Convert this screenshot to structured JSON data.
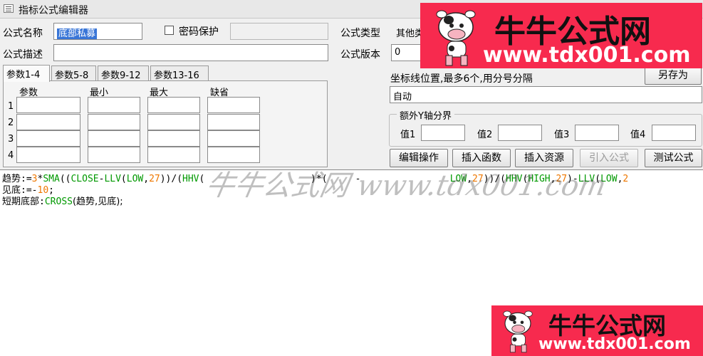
{
  "window": {
    "title": "指标公式编辑器"
  },
  "form": {
    "name_label": "公式名称",
    "name_value": "底部私募",
    "password_label": "密码保护",
    "password_value": "",
    "type_label": "公式类型",
    "type_value": "其他类",
    "desc_label": "公式描述",
    "desc_value": "",
    "version_label": "公式版本",
    "version_value": "0"
  },
  "tabs": [
    {
      "label": "参数1-4",
      "active": true
    },
    {
      "label": "参数5-8",
      "active": false
    },
    {
      "label": "参数9-12",
      "active": false
    },
    {
      "label": "参数13-16",
      "active": false
    }
  ],
  "params": {
    "headers": [
      "参数",
      "最小",
      "最大",
      "缺省"
    ],
    "rows": [
      "1",
      "2",
      "3",
      "4"
    ]
  },
  "coord": {
    "label": "坐标线位置,最多6个,用分号分隔",
    "value": "自动",
    "save_as_button": "另存为"
  },
  "yaxis": {
    "legend": "额外Y轴分界",
    "labels": [
      "值1",
      "值2",
      "值3",
      "值4"
    ]
  },
  "buttons": {
    "edit_ops": "编辑操作",
    "insert_func": "插入函数",
    "insert_resource": "插入资源",
    "import_formula": "引入公式",
    "test_formula": "测试公式"
  },
  "code": {
    "line1_name": "趋势",
    "line1_assign": ":=",
    "line1_n1": "3",
    "line1_star": "*",
    "line1_fn1": "SMA",
    "line1_p1": "((",
    "line1_fn2": "CLOSE",
    "line1_minus": "-",
    "line1_fn3": "LLV",
    "line1_p2": "(",
    "line1_fn4": "LOW",
    "line1_comma1": ",",
    "line1_n2": "27",
    "line1_p3": "))/(",
    "line1_fn5": "HHV",
    "line1_p4": "(",
    "line1_mid": "                   )*(     -                ",
    "line1_fn6": "LOW",
    "line1_comma2": ",",
    "line1_n3": "27",
    "line1_p5": "))/(",
    "line1_fn7": "HHV",
    "line1_p6": "(",
    "line1_fn8": "HIGH",
    "line1_comma3": ",",
    "line1_n4": "27",
    "line1_p7": ")-",
    "line1_fn9": "LLV",
    "line1_p8": "(",
    "line1_fn10": "LOW",
    "line1_comma4": ",",
    "line1_n5": "2",
    "line2_name": "见底",
    "line2_assign": ":=-",
    "line2_num": "10",
    "line2_end": ";",
    "line3_name": "短期底部",
    "line3_colon": ":",
    "line3_fn": "CROSS",
    "line3_args": "(趋势,见底);"
  },
  "ads": {
    "brand_name": "牛牛公式网",
    "url": "www.tdx001.com",
    "watermark": "牛牛公式网 www.tdx001.com",
    "bg_color": "#f72a4e"
  }
}
